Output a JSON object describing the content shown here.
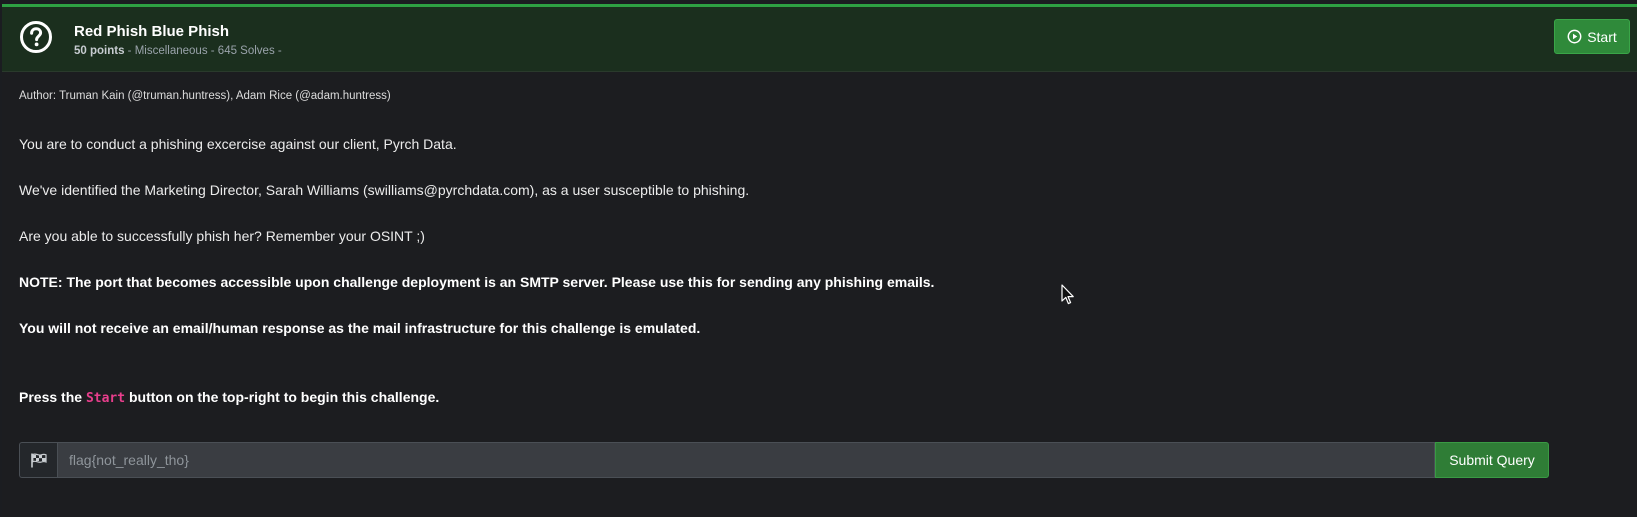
{
  "challenge": {
    "title": "Red Phish Blue Phish",
    "points": "50 points",
    "meta_rest": " - Miscellaneous - 645 Solves -",
    "start_label": "Start",
    "icon": "question-circle-icon"
  },
  "description": {
    "author": "Author: Truman Kain (@truman.huntress), Adam Rice (@adam.huntress)",
    "p1": "You are to conduct a phishing excercise against our client, Pyrch Data.",
    "p2": "We've identified the Marketing Director, Sarah Williams (swilliams@pyrchdata.com), as a user susceptible to phishing.",
    "p3": "Are you able to successfully phish her? Remember your OSINT ;)",
    "note1": "NOTE: The port that becomes accessible upon challenge deployment is an SMTP server. Please use this for sending any phishing emails.",
    "note2": "You will not receive an email/human response as the mail infrastructure for this challenge is emulated.",
    "press_before": "Press the ",
    "press_code": "Start",
    "press_after": " button on the top-right to begin this challenge."
  },
  "flag_form": {
    "icon": "flag-checkered-icon",
    "placeholder": "flag{not_really_tho}",
    "value": "",
    "submit_label": "Submit Query"
  },
  "colors": {
    "accent_green": "#2ea043",
    "header_bg": "#1b2f1e",
    "code_pink": "#e83e8c"
  }
}
